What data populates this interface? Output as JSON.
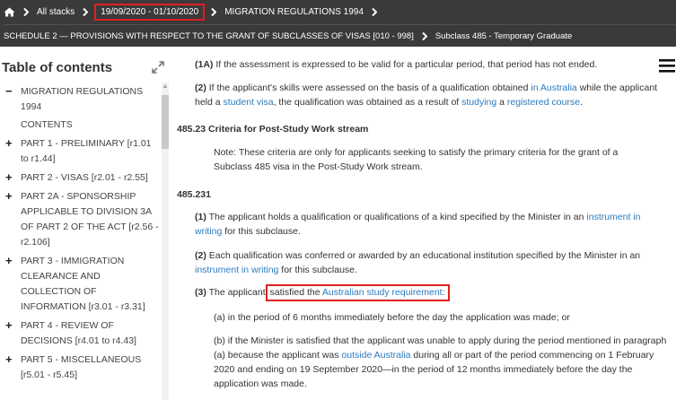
{
  "breadcrumb": {
    "home_icon": "home-icon",
    "all_stacks": "All stacks",
    "date_range": "19/09/2020 - 01/10/2020",
    "regulations": "MIGRATION REGULATIONS 1994",
    "schedule": "SCHEDULE 2 — PROVISIONS WITH RESPECT TO THE GRANT OF SUBCLASSES OF VISAS [010 - 998]",
    "subclass": "Subclass 485 - Temporary Graduate"
  },
  "toc": {
    "title": "Table of contents",
    "items": [
      {
        "sign": "−",
        "label": "MIGRATION REGULATIONS 1994"
      },
      {
        "sign": "",
        "label": "CONTENTS"
      },
      {
        "sign": "+",
        "label": "PART 1 - PRELIMINARY [r1.01 to r1.44]"
      },
      {
        "sign": "+",
        "label": "PART 2 - VISAS [r2.01 - r2.55]"
      },
      {
        "sign": "+",
        "label": "PART 2A - SPONSORSHIP APPLICABLE TO DIVISION 3A OF PART 2 OF THE ACT [r2.56 - r2.106]"
      },
      {
        "sign": "+",
        "label": "PART 3 - IMMIGRATION CLEARANCE AND COLLECTION OF INFORMATION [r3.01 - r3.31]"
      },
      {
        "sign": "+",
        "label": "PART 4 - REVIEW OF DECISIONS [r4.01 to r4.43]"
      },
      {
        "sign": "+",
        "label": "PART 5 - MISCELLANEOUS [r5.01 - r5.45]"
      }
    ]
  },
  "content": {
    "p1a_num": "(1A)",
    "p1a_text": "If the assessment is expressed to be valid for a particular period, that period has not ended.",
    "p2_num": "(2)",
    "p2_t1": "If the applicant's skills were assessed on the basis of a qualification obtained ",
    "p2_l1": "in Australia",
    "p2_t2": " while the applicant held a ",
    "p2_l2": "student visa",
    "p2_t3": ", the qualification was obtained as a result of ",
    "p2_l3": "studying",
    "p2_t4": " a ",
    "p2_l4": "registered course",
    "p2_t5": ".",
    "s1_head": "485.23  Criteria for Post-Study Work stream",
    "note": "Note:   These criteria are only for applicants seeking to satisfy the primary criteria for the grant of a Subclass 485 visa in the Post-Study Work stream.",
    "s2_head": "485.231",
    "q1_num": "(1)",
    "q1_t1": "The applicant holds a qualification or qualifications of a kind specified by the Minister in an ",
    "q1_l1": "instrument in writing",
    "q1_t2": " for this subclause.",
    "q2_num": "(2)",
    "q2_t1": "Each qualification was conferred or awarded by an educational institution specified by the Minister in an ",
    "q2_l1": "instrument in writing",
    "q2_t2": " for this subclause.",
    "q3_num": "(3)",
    "q3_t1": "The applicant",
    "q3_t2": " satisfied the ",
    "q3_l1": "Australian study requirement",
    "q3_t3": ":",
    "qa": "(a) in the period of 6 months immediately before the day the application was made; or",
    "qb_t1": "(b) if the Minister is satisfied that the applicant was unable to apply during the period mentioned in paragraph (a) because the applicant was ",
    "qb_l1": "outside Australia",
    "qb_t2": " during all or part of the period commencing on 1 February 2020 and ending on 19 September 2020—in the period of 12 months immediately before the day the application was made."
  },
  "colors": {
    "header_bg": "#3a3a3a",
    "link": "#2b7bbf",
    "highlight_border": "#e02020"
  }
}
